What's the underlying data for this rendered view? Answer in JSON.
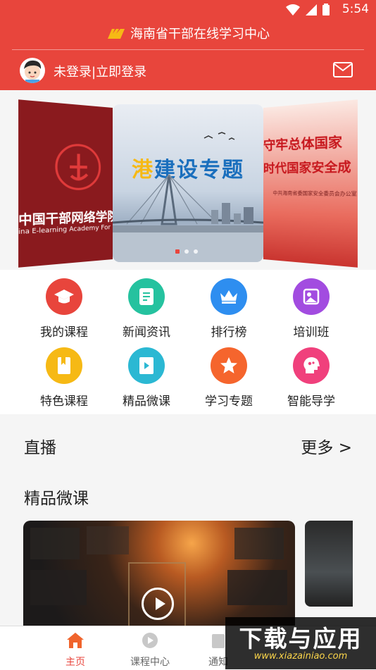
{
  "status_bar": {
    "time": "5:54"
  },
  "header": {
    "title": "海南省干部在线学习中心",
    "login_text": "未登录|立即登录"
  },
  "carousel": {
    "left_title": "中国干部网络学院",
    "left_subtitle": "ina E-learning Academy For Leadership",
    "center_title": "建设专题",
    "center_title_prefix": "港",
    "right_line1": "守牢总体国家",
    "right_line2": "时代国家安全成",
    "right_small": "中共海南省委国家安全委员会办公室",
    "active_index": 0
  },
  "menu": [
    {
      "label": "我的课程",
      "icon": "graduation-cap-icon",
      "color": "#e8453c"
    },
    {
      "label": "新闻资讯",
      "icon": "news-icon",
      "color": "#25c29f"
    },
    {
      "label": "排行榜",
      "icon": "crown-icon",
      "color": "#2e8ef0"
    },
    {
      "label": "培训班",
      "icon": "training-icon",
      "color": "#a24ce0"
    },
    {
      "label": "特色课程",
      "icon": "bookmark-book-icon",
      "color": "#f6b915"
    },
    {
      "label": "精品微课",
      "icon": "video-book-icon",
      "color": "#2bb8d3"
    },
    {
      "label": "学习专题",
      "icon": "star-icon",
      "color": "#f5652d"
    },
    {
      "label": "智能导学",
      "icon": "head-brain-icon",
      "color": "#f0407c"
    }
  ],
  "live": {
    "title": "直播",
    "more": "更多 >"
  },
  "micro": {
    "title": "精品微课"
  },
  "bottom_nav": [
    {
      "label": "主页",
      "icon": "home-icon",
      "active": true
    },
    {
      "label": "课程中心",
      "icon": "play-circle-icon",
      "active": false
    },
    {
      "label": "通知",
      "icon": "notice-icon",
      "active": false
    }
  ],
  "watermark": {
    "text": "下载与应用",
    "url": "www.xiazainiao.com"
  }
}
